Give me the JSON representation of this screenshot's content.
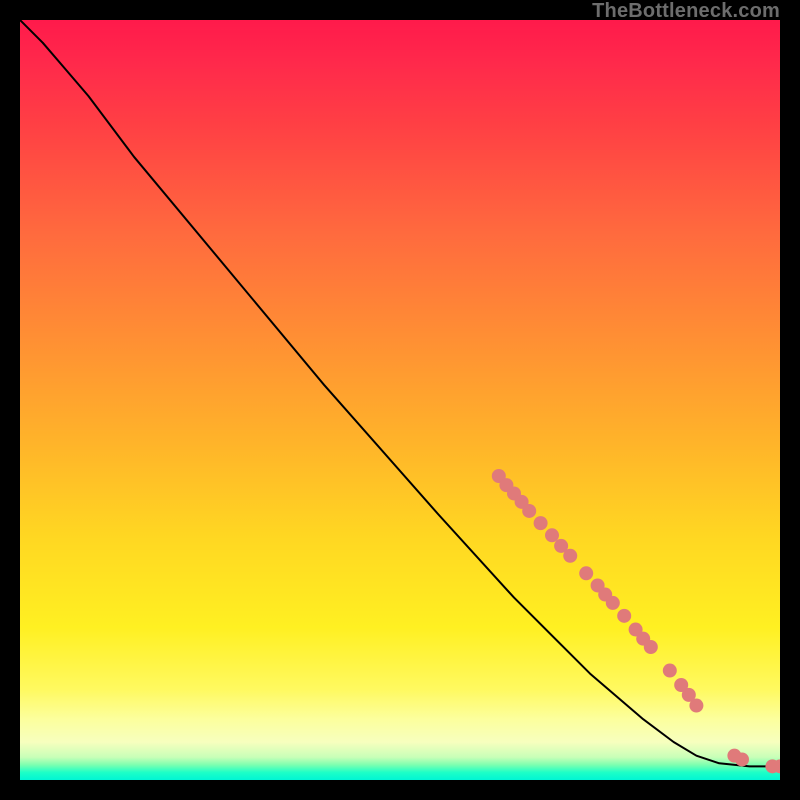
{
  "watermark": "TheBottleneck.com",
  "chart_data": {
    "type": "line",
    "title": "",
    "xlabel": "",
    "ylabel": "",
    "xlim": [
      0,
      100
    ],
    "ylim": [
      0,
      100
    ],
    "grid": false,
    "legend": false,
    "line_color": "#000000",
    "line_width": 2,
    "marker_color": "#e07a7a",
    "marker_radius": 7,
    "curve": [
      {
        "x": 0,
        "y": 100
      },
      {
        "x": 3,
        "y": 97
      },
      {
        "x": 6,
        "y": 93.5
      },
      {
        "x": 9,
        "y": 90
      },
      {
        "x": 15,
        "y": 82
      },
      {
        "x": 25,
        "y": 70
      },
      {
        "x": 40,
        "y": 52
      },
      {
        "x": 55,
        "y": 35
      },
      {
        "x": 65,
        "y": 24
      },
      {
        "x": 75,
        "y": 14
      },
      {
        "x": 82,
        "y": 8
      },
      {
        "x": 86,
        "y": 5
      },
      {
        "x": 89,
        "y": 3.2
      },
      {
        "x": 92,
        "y": 2.2
      },
      {
        "x": 96,
        "y": 1.8
      },
      {
        "x": 100,
        "y": 1.8
      }
    ],
    "markers": [
      {
        "x": 63.0,
        "y": 40.0
      },
      {
        "x": 64.0,
        "y": 38.8
      },
      {
        "x": 65.0,
        "y": 37.7
      },
      {
        "x": 66.0,
        "y": 36.6
      },
      {
        "x": 67.0,
        "y": 35.4
      },
      {
        "x": 68.5,
        "y": 33.8
      },
      {
        "x": 70.0,
        "y": 32.2
      },
      {
        "x": 71.2,
        "y": 30.8
      },
      {
        "x": 72.4,
        "y": 29.5
      },
      {
        "x": 74.5,
        "y": 27.2
      },
      {
        "x": 76.0,
        "y": 25.6
      },
      {
        "x": 77.0,
        "y": 24.4
      },
      {
        "x": 78.0,
        "y": 23.3
      },
      {
        "x": 79.5,
        "y": 21.6
      },
      {
        "x": 81.0,
        "y": 19.8
      },
      {
        "x": 82.0,
        "y": 18.6
      },
      {
        "x": 83.0,
        "y": 17.5
      },
      {
        "x": 85.5,
        "y": 14.4
      },
      {
        "x": 87.0,
        "y": 12.5
      },
      {
        "x": 88.0,
        "y": 11.2
      },
      {
        "x": 89.0,
        "y": 9.8
      },
      {
        "x": 94.0,
        "y": 3.2
      },
      {
        "x": 95.0,
        "y": 2.7
      },
      {
        "x": 99.0,
        "y": 1.8
      },
      {
        "x": 100.0,
        "y": 1.8
      }
    ]
  }
}
